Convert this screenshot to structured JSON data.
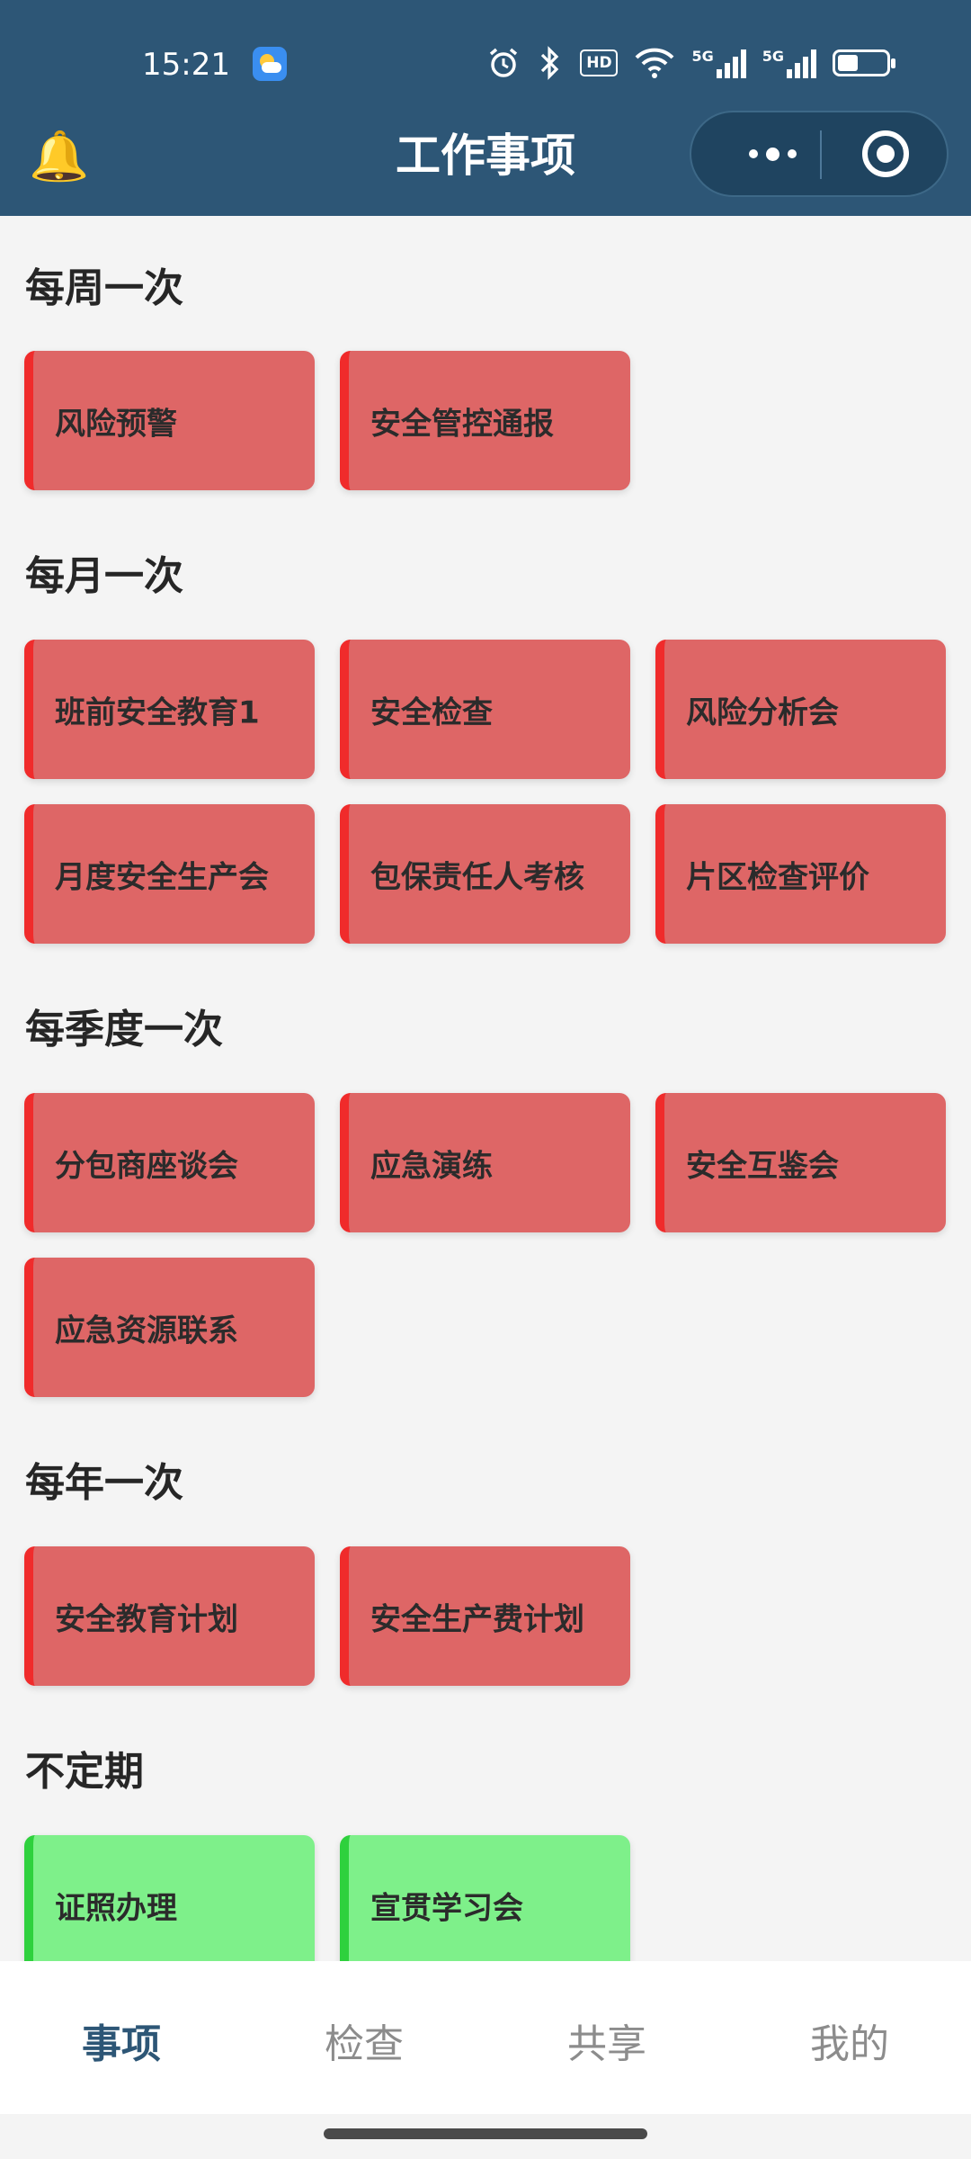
{
  "status_bar": {
    "time": "15:21",
    "hd_label": "HD",
    "network_1": "5G",
    "network_2": "5G"
  },
  "header": {
    "title": "工作事项",
    "bell_icon": "🔔"
  },
  "sections": [
    {
      "title": "每周一次",
      "items": [
        "风险预警",
        "安全管控通报"
      ]
    },
    {
      "title": "每月一次",
      "items": [
        "班前安全教育1",
        "安全检查",
        "风险分析会",
        "月度安全生产会",
        "包保责任人考核",
        "片区检查评价"
      ]
    },
    {
      "title": "每季度一次",
      "items": [
        "分包商座谈会",
        "应急演练",
        "安全互鉴会",
        "应急资源联系"
      ]
    },
    {
      "title": "每年一次",
      "items": [
        "安全教育计划",
        "安全生产费计划"
      ]
    },
    {
      "title": "不定期",
      "items": [
        "证照办理",
        "宣贯学习会"
      ]
    }
  ],
  "tabs": [
    "事项",
    "检查",
    "共享",
    "我的"
  ],
  "colors": {
    "header_bg": "#2d5676",
    "card_red": "#de6666",
    "card_red_accent": "#f02b2b",
    "card_green": "#7ef08a",
    "card_green_accent": "#2ed13d",
    "tab_active": "#2d5676"
  }
}
